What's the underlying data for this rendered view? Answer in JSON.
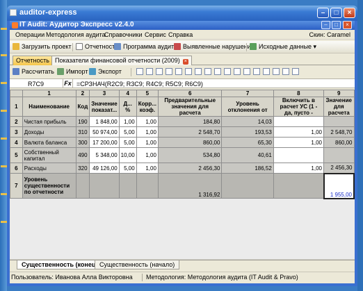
{
  "outer_window": {
    "title": "auditor-express"
  },
  "inner_window": {
    "title": "IT Audit: Аудитор Экспресс v2.4.0"
  },
  "menu": {
    "items": [
      "Операции",
      "Методология аудита",
      "Справочники",
      "Сервис",
      "Справка"
    ],
    "skin": "Скин: Caramel"
  },
  "toolbar": {
    "load_project": "Загрузить проект",
    "report": "Отчетность",
    "audit_program": "Программа аудита",
    "violations": "Выявленные нарушения",
    "source_data": "Исходные данные"
  },
  "doc_tabs": [
    {
      "label": "Отчетность"
    },
    {
      "label": "Показатели финансовой отчетности (2009)"
    }
  ],
  "sheet_toolbar": {
    "calculate": "Рассчитать",
    "import": "Импорт",
    "export": "Экспорт"
  },
  "formula_bar": {
    "cell": "R7C9",
    "fx": "Fx",
    "formula": "=СРЗНАЧ(R2C9; R3C9; R4C9; R5C9; R6C9)"
  },
  "grid": {
    "col_numbers": [
      "",
      "1",
      "2",
      "3",
      "4",
      "5",
      "6",
      "7",
      "8",
      "9"
    ],
    "headers": [
      "",
      "Наименование",
      "Код",
      "Значение показат...",
      "Д... %",
      "Корр... коэф.",
      "Предварительные значения для расчета",
      "Уровень отклонения от",
      "Включить в расчет УС (1 - да, пусто -",
      "Значение для расчета"
    ],
    "rows": [
      {
        "n": "2",
        "name": "Чистая прибыль",
        "code": "190",
        "value": "1 848,00",
        "pct": "1,00",
        "coef": "1,00",
        "prelim": "184,80",
        "dev": "14,03",
        "incl": "",
        "calc": ""
      },
      {
        "n": "3",
        "name": "Доходы",
        "code": "310",
        "value": "50 974,00",
        "pct": "5,00",
        "coef": "1,00",
        "prelim": "2 548,70",
        "dev": "193,53",
        "incl": "1,00",
        "calc": "2 548,70"
      },
      {
        "n": "4",
        "name": "Валюта баланса",
        "code": "300",
        "value": "17 200,00",
        "pct": "5,00",
        "coef": "1,00",
        "prelim": "860,00",
        "dev": "65,30",
        "incl": "1,00",
        "calc": "860,00"
      },
      {
        "n": "5",
        "name": "Собственный капитал",
        "code": "490",
        "value": "5 348,00",
        "pct": "10,00",
        "coef": "1,00",
        "prelim": "534,80",
        "dev": "40,61",
        "incl": "",
        "calc": ""
      },
      {
        "n": "6",
        "name": "Расходы",
        "code": "320",
        "value": "49 126,00",
        "pct": "5,00",
        "coef": "1,00",
        "prelim": "2 456,30",
        "dev": "186,52",
        "incl": "1,00",
        "calc": "2 456,30"
      }
    ],
    "total": {
      "n": "7",
      "name": "Уровень существенности по отчетности",
      "prelim": "1 316,92",
      "calc": "1 955,00"
    }
  },
  "sheet_tabs": [
    "Существенность (конец)",
    "Существенность (начало)"
  ],
  "status": {
    "user": "Пользователь: Иванова Алла Викторовна",
    "methodology": "Методология: Методология аудита (IT Audit & Pravo)"
  }
}
